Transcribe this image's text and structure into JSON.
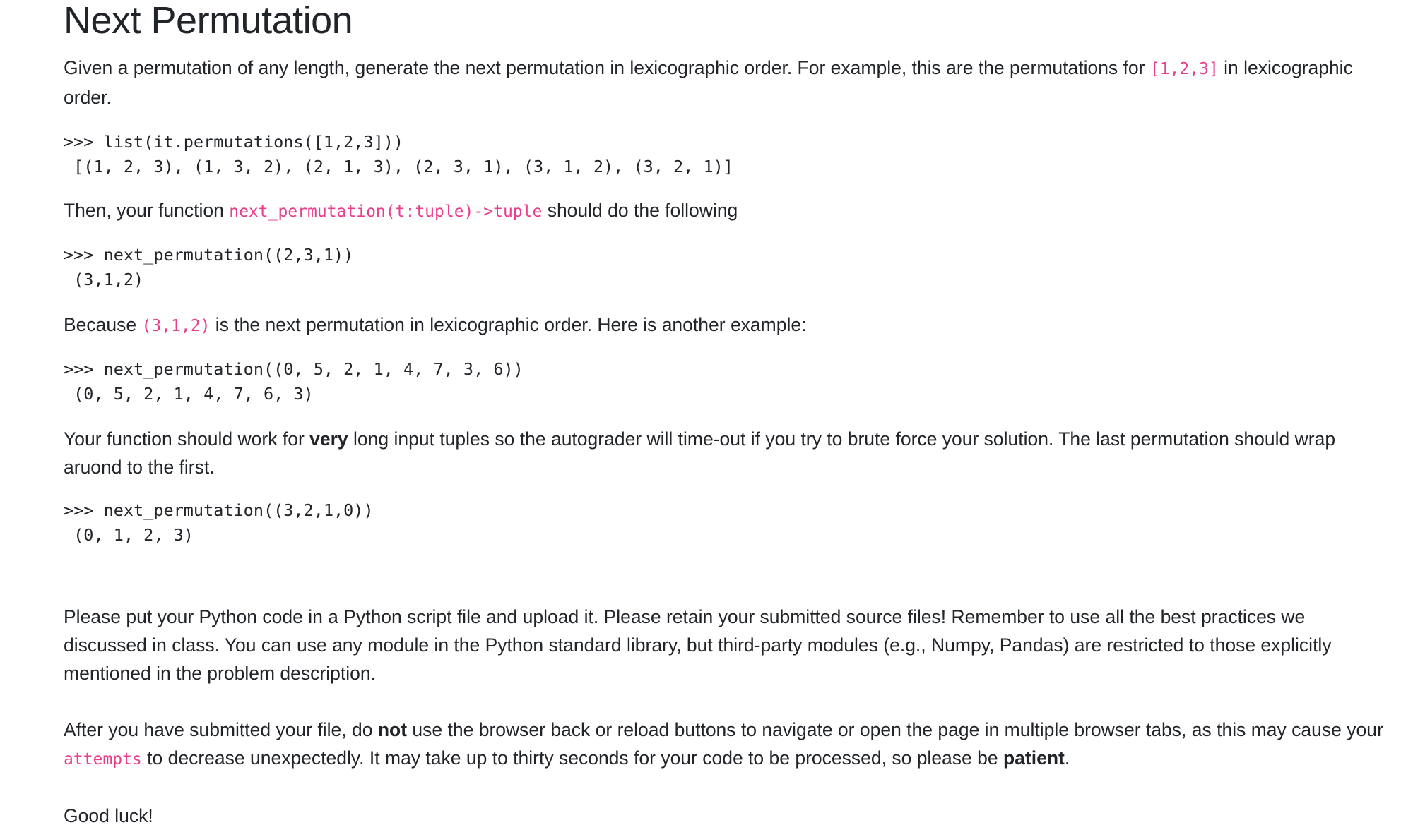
{
  "title": "Next Permutation",
  "intro": {
    "text_before": "Given a permutation of any length, generate the next permutation in lexicographic order. For example, this are the permutations for ",
    "code": "[1,2,3]",
    "text_after": " in lexicographic order."
  },
  "example1": {
    "prompt_line": ">>> list(it.permutations([1,2,3]))",
    "output_line": " [(1, 2, 3), (1, 3, 2), (2, 1, 3), (2, 3, 1), (3, 1, 2), (3, 2, 1)]"
  },
  "then": {
    "text_before": "Then, your function ",
    "code": "next_permutation(t:tuple)->tuple",
    "text_after": " should do the following"
  },
  "example2": {
    "prompt_line": ">>> next_permutation((2,3,1))",
    "output_line": " (3,1,2)"
  },
  "because": {
    "text_before": "Because ",
    "code": "(3,1,2)",
    "text_after": " is the next permutation in lexicographic order. Here is another example:"
  },
  "example3": {
    "prompt_line": ">>> next_permutation((0, 5, 2, 1, 4, 7, 3, 6))",
    "output_line": " (0, 5, 2, 1, 4, 7, 6, 3)"
  },
  "long_input": {
    "text_before": "Your function should work for ",
    "bold": "very",
    "text_after": " long input tuples so the autograder will time-out if you try to brute force your solution. The last permutation should wrap aruond to the first."
  },
  "example4": {
    "prompt_line": ">>> next_permutation((3,2,1,0))",
    "output_line": " (0, 1, 2, 3)"
  },
  "upload_note": "Please put your Python code in a Python script file and upload it. Please retain your submitted source files! Remember to use all the best practices we discussed in class. You can use any module in the Python standard library, but third-party modules (e.g., Numpy, Pandas) are restricted to those explicitly mentioned in the problem description.",
  "submit_note": {
    "text_before": "After you have submitted your file, do ",
    "bold_not": "not",
    "text_middle": " use the browser back or reload buttons to navigate or open the page in multiple browser tabs, as this may cause your ",
    "code": "attempts",
    "text_after": " to decrease unexpectedly. It may take up to thirty seconds for your code to be processed, so please be ",
    "bold_patient": "patient",
    "text_end": "."
  },
  "closing": "Good luck!",
  "colors": {
    "text": "#212529",
    "inline_code": "#e83e8c",
    "background": "#ffffff"
  }
}
